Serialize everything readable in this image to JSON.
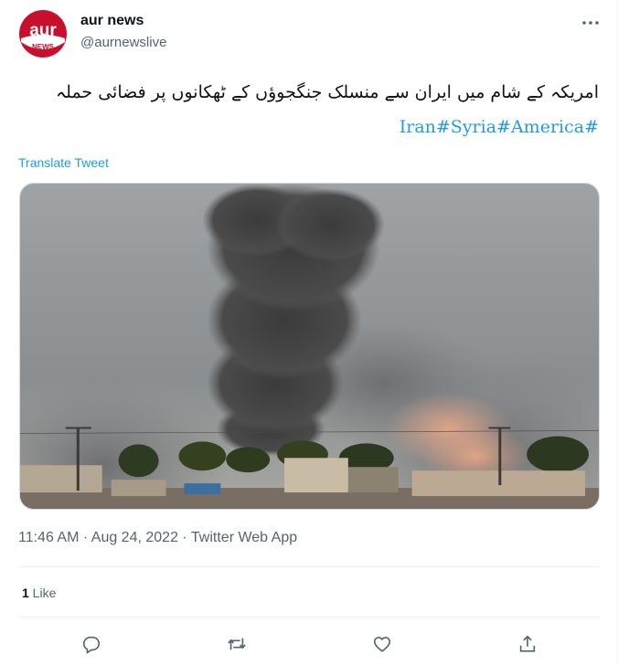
{
  "author": {
    "avatar_text_top": "aur",
    "avatar_text_bottom": "NEWS",
    "name": "aur news",
    "handle": "@aurnewslive"
  },
  "tweet": {
    "text": "امریکہ کے شام میں ایران سے منسلک جنگجوؤں کے ٹھکانوں پر فضائی حملہ",
    "hashtags": "Iran#Syria#America#",
    "translate_label": "Translate Tweet"
  },
  "meta": {
    "time": "11:46 AM",
    "sep1": " · ",
    "date": "Aug 24, 2022",
    "sep2": " · ",
    "source": "Twitter Web App"
  },
  "stats": {
    "likes_count": "1",
    "likes_label": " Like"
  },
  "colors": {
    "accent": "#1d9bf0",
    "brand_red": "#c8102e",
    "secondary_text": "#536471"
  },
  "icons": {
    "more": "more-dots-icon",
    "reply": "reply-icon",
    "retweet": "retweet-icon",
    "like": "heart-icon",
    "share": "share-icon"
  }
}
